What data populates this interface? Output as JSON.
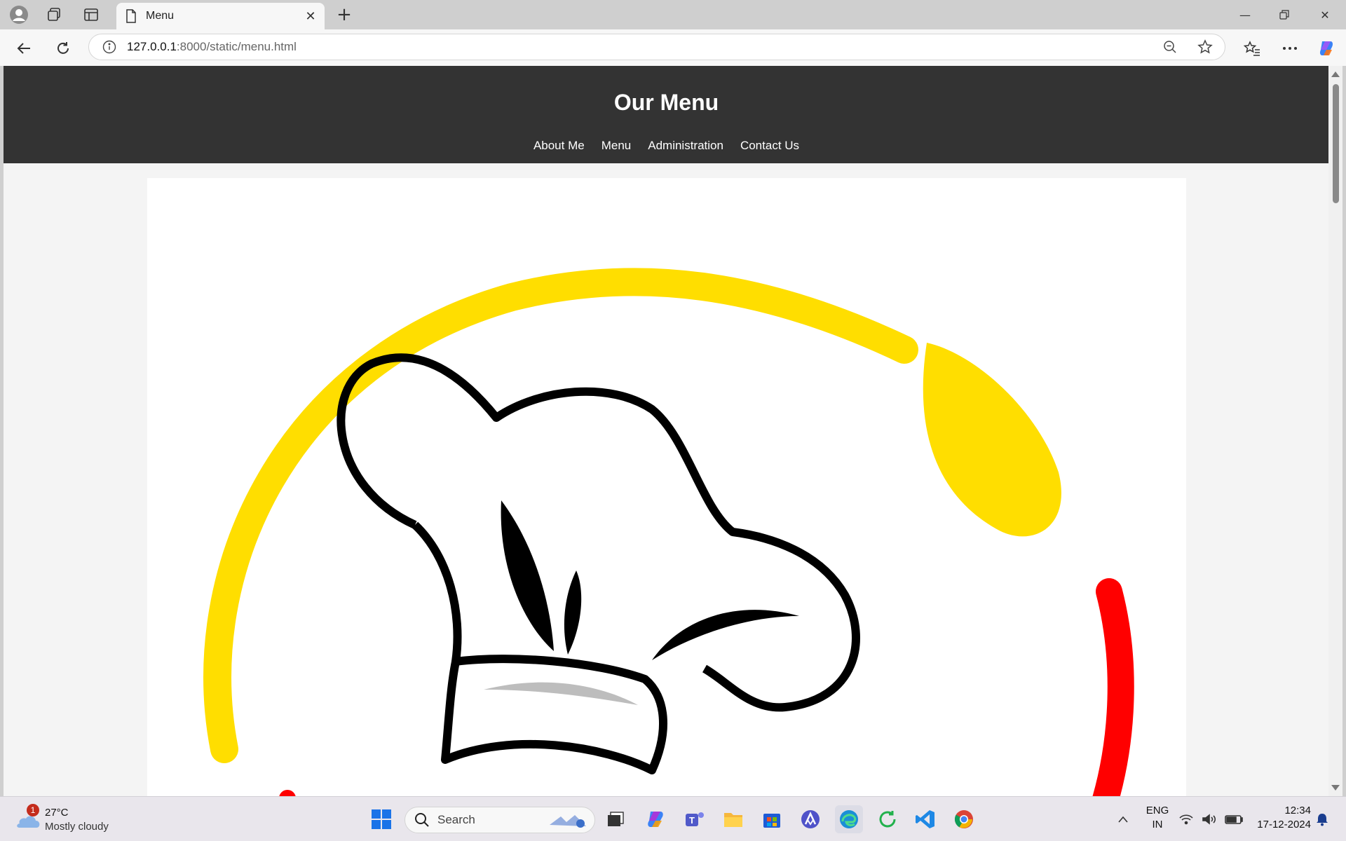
{
  "browser": {
    "tab_title": "Menu",
    "url_host": "127.0.0.1",
    "url_rest": ":8000/static/menu.html"
  },
  "page": {
    "title": "Our Menu",
    "nav": [
      "About Me",
      "Menu",
      "Administration",
      "Contact Us"
    ],
    "logo_colors": {
      "arc": "#FFDE00",
      "accent": "#FF0000",
      "outline": "#000000"
    }
  },
  "taskbar": {
    "weather_badge": "1",
    "temperature": "27°C",
    "condition": "Mostly cloudy",
    "search_placeholder": "Search",
    "lang_line1": "ENG",
    "lang_line2": "IN",
    "time": "12:34",
    "date": "17-12-2024"
  }
}
